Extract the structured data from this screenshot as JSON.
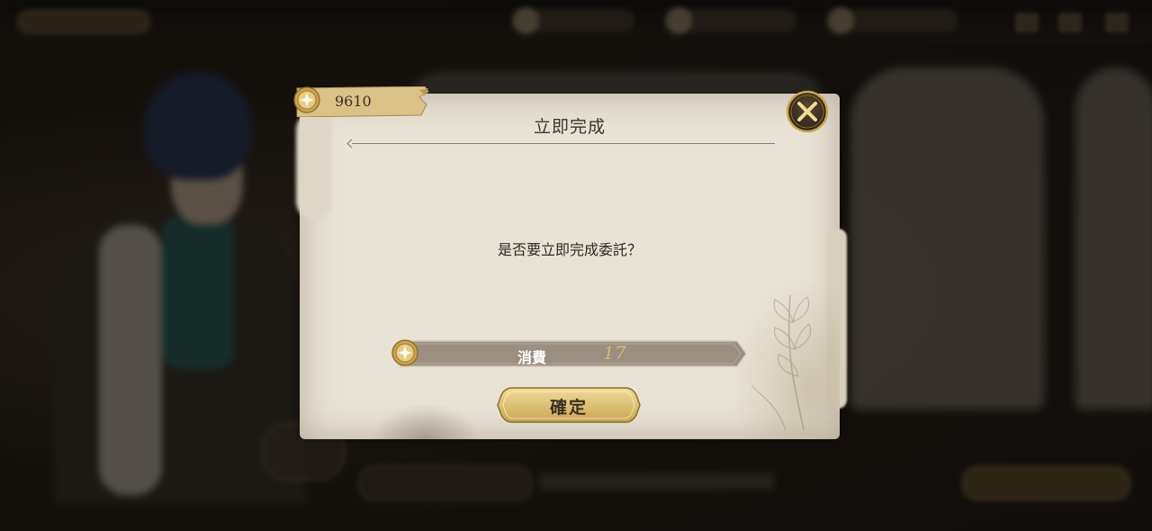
{
  "dialog": {
    "title": "立即完成",
    "message": "是否要立即完成委託？",
    "cost_label": "消費",
    "cost_value": "17",
    "confirm_label": "確定"
  },
  "currency": {
    "amount": "9610"
  },
  "icons": {
    "close": "close-icon",
    "coin": "gold-coin-icon"
  },
  "colors": {
    "paper": "#e9e3d6",
    "accent_gold": "#d8ba6c",
    "cost_bar": "#9a8f80"
  }
}
